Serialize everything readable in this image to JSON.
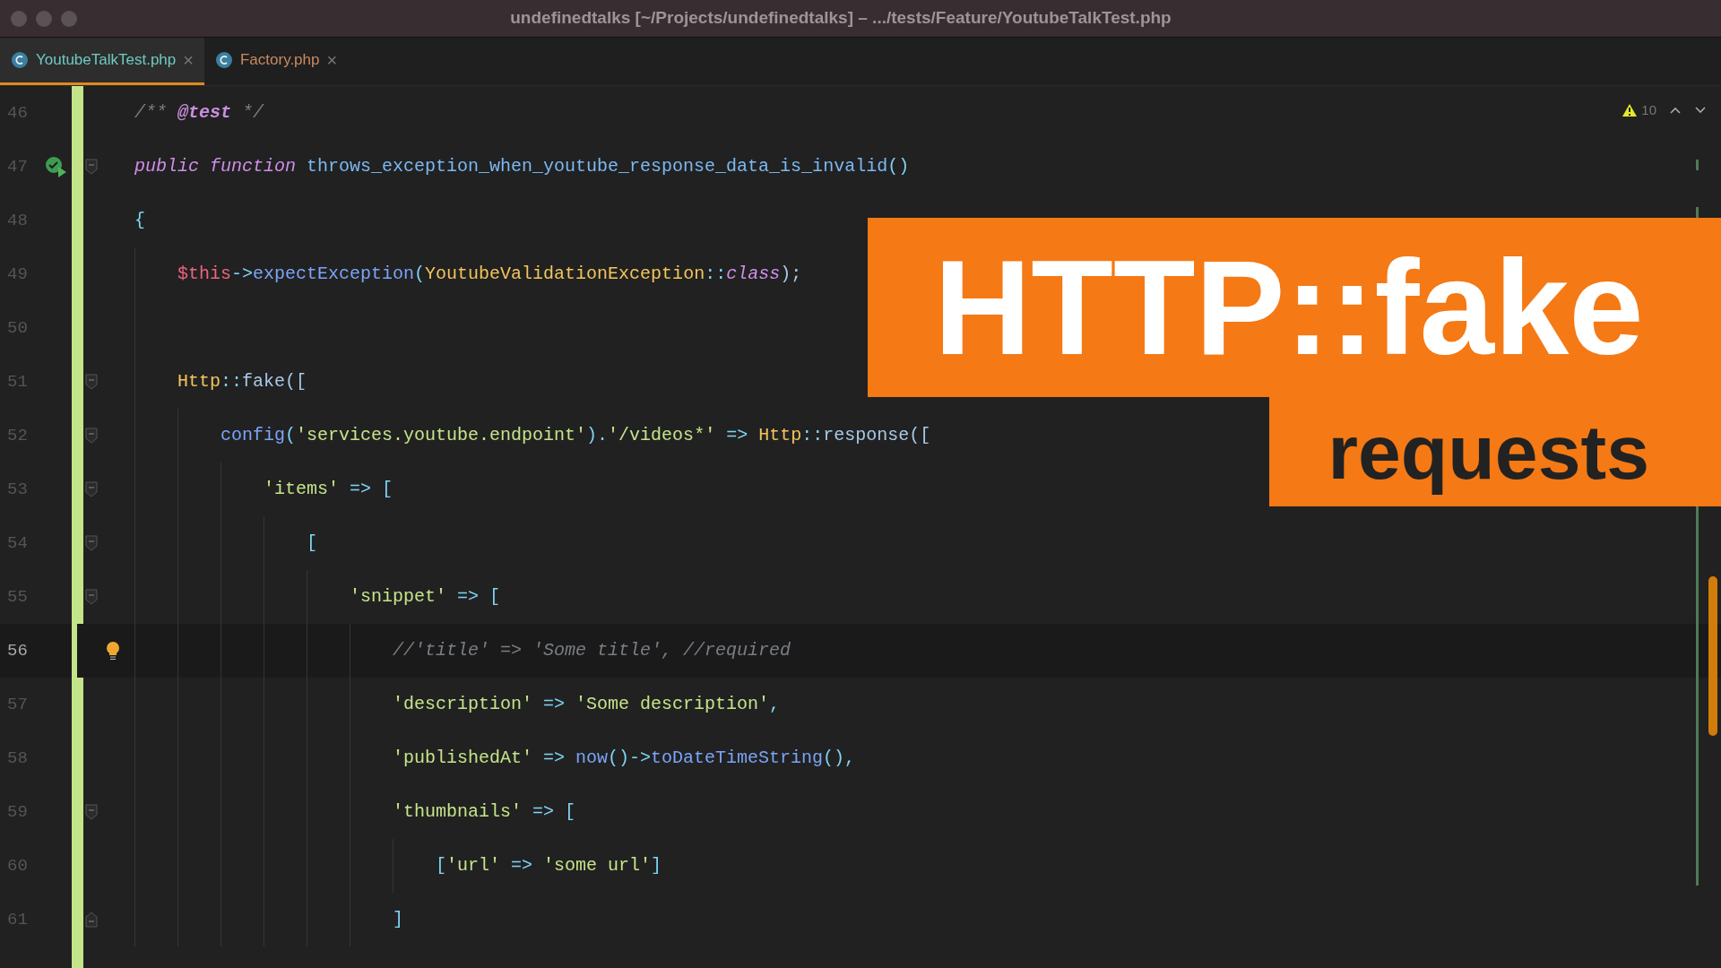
{
  "window": {
    "title": "undefinedtalks [~/Projects/undefinedtalks] – .../tests/Feature/YoutubeTalkTest.php"
  },
  "tabs": [
    {
      "label": "YoutubeTalkTest.php",
      "selected": true,
      "color": "#6fc9c2",
      "close": "×"
    },
    {
      "label": "Factory.php",
      "selected": false,
      "color": "#c98a62",
      "close": "×"
    }
  ],
  "inspections": {
    "warnings": "10"
  },
  "lines": [
    {
      "number": "46",
      "current": false,
      "tokens": [
        {
          "kind": "comment",
          "text": "/** "
        },
        {
          "kind": "doctag",
          "text": "@test"
        },
        {
          "kind": "comment",
          "text": " */"
        }
      ]
    },
    {
      "number": "47",
      "current": false,
      "run_icon": true,
      "fold_start": true,
      "tokens": [
        {
          "kind": "keyword",
          "text": "public function "
        },
        {
          "kind": "func",
          "text": "throws_exception_when_youtube_response_data_is_invalid"
        },
        {
          "kind": "punct",
          "text": "()"
        }
      ]
    },
    {
      "number": "48",
      "current": false,
      "tokens": [
        {
          "kind": "punct",
          "text": "{"
        }
      ],
      "children": [
        {
          "number": "49",
          "current": false,
          "tokens": [
            {
              "kind": "var",
              "text": "$this"
            },
            {
              "kind": "punct",
              "text": "->"
            },
            {
              "kind": "method",
              "text": "expectException"
            },
            {
              "kind": "punct",
              "text": "("
            },
            {
              "kind": "class",
              "text": "YoutubeValidationException"
            },
            {
              "kind": "punct",
              "text": "::"
            },
            {
              "kind": "keyword",
              "text": "class"
            },
            {
              "kind": "plain",
              "text": ");"
            }
          ]
        },
        {
          "number": "50",
          "current": false
        },
        {
          "number": "51",
          "current": false,
          "fold_start": true,
          "tokens": [
            {
              "kind": "class",
              "text": "Http"
            },
            {
              "kind": "punct",
              "text": "::"
            },
            {
              "kind": "plain",
              "text": "fake(["
            }
          ],
          "children": [
            {
              "number": "52",
              "current": false,
              "fold_start": true,
              "tokens": [
                {
                  "kind": "method",
                  "text": "config"
                },
                {
                  "kind": "punct",
                  "text": "("
                },
                {
                  "kind": "string",
                  "text": "'services.youtube.endpoint'"
                },
                {
                  "kind": "punct",
                  "text": ")."
                },
                {
                  "kind": "string",
                  "text": "'/videos*'"
                },
                {
                  "kind": "punct",
                  "text": " => "
                },
                {
                  "kind": "class",
                  "text": "Http"
                },
                {
                  "kind": "punct",
                  "text": "::"
                },
                {
                  "kind": "plain",
                  "text": "response(["
                }
              ],
              "children": [
                {
                  "number": "53",
                  "current": false,
                  "fold_start": true,
                  "tokens": [
                    {
                      "kind": "string",
                      "text": "'items'"
                    },
                    {
                      "kind": "punct",
                      "text": " => ["
                    }
                  ],
                  "children": [
                    {
                      "number": "54",
                      "current": false,
                      "fold_start": true,
                      "tokens": [
                        {
                          "kind": "punct",
                          "text": "["
                        }
                      ],
                      "children": [
                        {
                          "number": "55",
                          "current": false,
                          "fold_start": true,
                          "tokens": [
                            {
                              "kind": "string",
                              "text": "'snippet'"
                            },
                            {
                              "kind": "punct",
                              "text": " => ["
                            }
                          ],
                          "children": [
                            {
                              "number": "56",
                              "current": true,
                              "bulb": true,
                              "tokens": [
                                {
                                  "kind": "comment",
                                  "text": "//'title' => 'Some title', //required"
                                }
                              ]
                            },
                            {
                              "number": "57",
                              "current": false,
                              "tokens": [
                                {
                                  "kind": "string",
                                  "text": "'description'"
                                },
                                {
                                  "kind": "punct",
                                  "text": " => "
                                },
                                {
                                  "kind": "string",
                                  "text": "'Some description'"
                                },
                                {
                                  "kind": "punct",
                                  "text": ","
                                }
                              ]
                            },
                            {
                              "number": "58",
                              "current": false,
                              "tokens": [
                                {
                                  "kind": "string",
                                  "text": "'publishedAt'"
                                },
                                {
                                  "kind": "punct",
                                  "text": " => "
                                },
                                {
                                  "kind": "method",
                                  "text": "now"
                                },
                                {
                                  "kind": "punct",
                                  "text": "()->"
                                },
                                {
                                  "kind": "method",
                                  "text": "toDateTimeString"
                                },
                                {
                                  "kind": "punct",
                                  "text": "(),"
                                }
                              ]
                            },
                            {
                              "number": "59",
                              "current": false,
                              "fold_start": true,
                              "tokens": [
                                {
                                  "kind": "string",
                                  "text": "'thumbnails'"
                                },
                                {
                                  "kind": "punct",
                                  "text": " => ["
                                }
                              ],
                              "children": [
                                {
                                  "number": "60",
                                  "current": false,
                                  "tokens": [
                                    {
                                      "kind": "punct",
                                      "text": "["
                                    },
                                    {
                                      "kind": "string",
                                      "text": "'url'"
                                    },
                                    {
                                      "kind": "punct",
                                      "text": " => "
                                    },
                                    {
                                      "kind": "string",
                                      "text": "'some url'"
                                    },
                                    {
                                      "kind": "punct",
                                      "text": "]"
                                    }
                                  ]
                                }
                              ]
                            },
                            {
                              "number": "61",
                              "current": false,
                              "fold_end": true,
                              "tokens": [
                                {
                                  "kind": "punct",
                                  "text": "]"
                                }
                              ]
                            }
                          ]
                        }
                      ]
                    }
                  ]
                }
              ]
            }
          ]
        }
      ]
    }
  ],
  "overlay": {
    "title": "HTTP::fake",
    "subtitle": "requests"
  }
}
